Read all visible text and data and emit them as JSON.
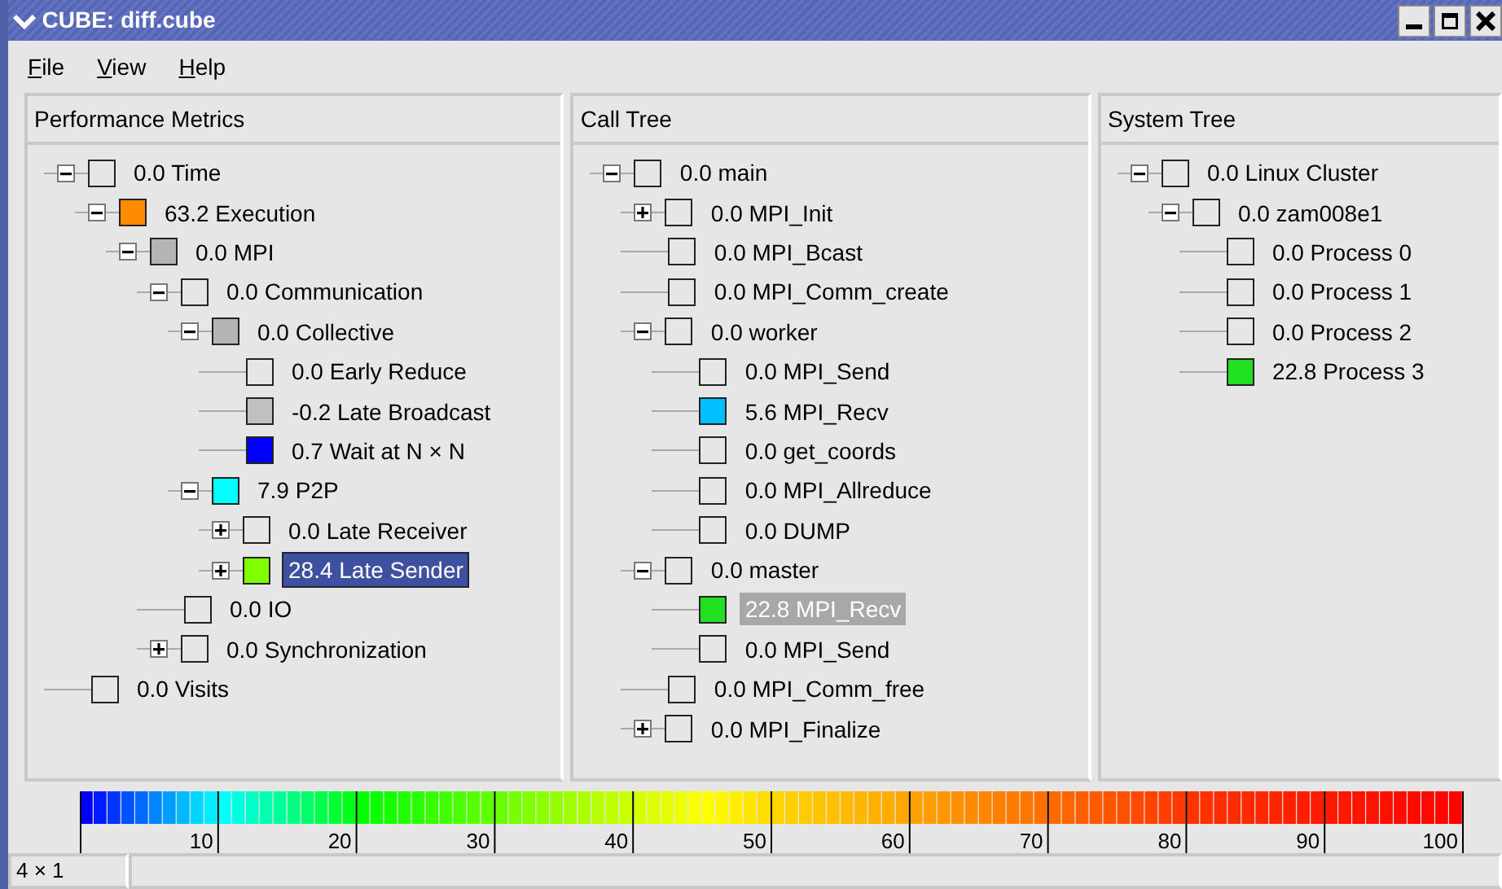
{
  "window": {
    "title": "CUBE:  diff.cube"
  },
  "menu": [
    {
      "label": "File"
    },
    {
      "label": "View"
    },
    {
      "label": "Help"
    }
  ],
  "panels": [
    {
      "title": "Performance Metrics",
      "tree": [
        {
          "label": "0.0 Time",
          "color": "#e6e6e6",
          "expanded": true,
          "selected": false,
          "children": [
            {
              "label": "63.2 Execution",
              "color": "#ff8c00",
              "expanded": true,
              "selected": false,
              "children": [
                {
                  "label": "0.0 MPI",
                  "color": "#b4b4b4",
                  "expanded": true,
                  "selected": false,
                  "children": [
                    {
                      "label": "0.0 Communication",
                      "color": "#e6e6e6",
                      "expanded": true,
                      "selected": false,
                      "children": [
                        {
                          "label": "0.0 Collective",
                          "color": "#b4b4b4",
                          "expanded": true,
                          "selected": false,
                          "children": [
                            {
                              "label": "0.0 Early Reduce",
                              "color": "#e6e6e6",
                              "selected": false
                            },
                            {
                              "label": "-0.2 Late Broadcast",
                              "color": "#c0c0c0",
                              "selected": false
                            },
                            {
                              "label": "0.7 Wait at N × N",
                              "color": "#0000ff",
                              "selected": false
                            }
                          ]
                        },
                        {
                          "label": "7.9 P2P",
                          "color": "#00ffff",
                          "expanded": true,
                          "selected": false,
                          "children": [
                            {
                              "label": "0.0 Late Receiver",
                              "color": "#e6e6e6",
                              "expanded": false,
                              "selected": false
                            },
                            {
                              "label": "28.4 Late Sender",
                              "color": "#80ff00",
                              "expanded": false,
                              "selected": true,
                              "focused": true
                            }
                          ]
                        }
                      ]
                    },
                    {
                      "label": "0.0 IO",
                      "color": "#e6e6e6",
                      "selected": false
                    },
                    {
                      "label": "0.0 Synchronization",
                      "color": "#e6e6e6",
                      "expanded": false,
                      "selected": false
                    }
                  ]
                }
              ]
            }
          ]
        },
        {
          "label": "0.0 Visits",
          "color": "#e6e6e6",
          "selected": false
        }
      ]
    },
    {
      "title": "Call Tree",
      "tree": [
        {
          "label": "0.0 main",
          "color": "#e6e6e6",
          "expanded": true,
          "selected": false,
          "children": [
            {
              "label": "0.0 MPI_Init",
              "color": "#e6e6e6",
              "expanded": false,
              "selected": false
            },
            {
              "label": "0.0 MPI_Bcast",
              "color": "#e6e6e6",
              "selected": false
            },
            {
              "label": "0.0 MPI_Comm_create",
              "color": "#e6e6e6",
              "selected": false
            },
            {
              "label": "0.0 worker",
              "color": "#e6e6e6",
              "expanded": true,
              "selected": false,
              "children": [
                {
                  "label": "0.0 MPI_Send",
                  "color": "#e6e6e6",
                  "selected": false
                },
                {
                  "label": "5.6 MPI_Recv",
                  "color": "#00bfff",
                  "selected": false
                },
                {
                  "label": "0.0 get_coords",
                  "color": "#e6e6e6",
                  "selected": false
                },
                {
                  "label": "0.0 MPI_Allreduce",
                  "color": "#e6e6e6",
                  "selected": false
                },
                {
                  "label": "0.0 DUMP",
                  "color": "#e6e6e6",
                  "selected": false
                }
              ]
            },
            {
              "label": "0.0 master",
              "color": "#e6e6e6",
              "expanded": true,
              "selected": false,
              "children": [
                {
                  "label": "22.8 MPI_Recv",
                  "color": "#20e020",
                  "selected": true,
                  "focused": false
                },
                {
                  "label": "0.0 MPI_Send",
                  "color": "#e6e6e6",
                  "selected": false
                }
              ]
            },
            {
              "label": "0.0 MPI_Comm_free",
              "color": "#e6e6e6",
              "selected": false
            },
            {
              "label": "0.0 MPI_Finalize",
              "color": "#e6e6e6",
              "expanded": false,
              "selected": false
            }
          ]
        }
      ]
    },
    {
      "title": "System Tree",
      "tree": [
        {
          "label": "0.0 Linux Cluster",
          "color": "#e6e6e6",
          "expanded": true,
          "selected": false,
          "children": [
            {
              "label": "0.0 zam008e1",
              "color": "#e6e6e6",
              "expanded": true,
              "selected": false,
              "children": [
                {
                  "label": "0.0 Process 0",
                  "color": "#e6e6e6",
                  "selected": false
                },
                {
                  "label": "0.0 Process 1",
                  "color": "#e6e6e6",
                  "selected": false
                },
                {
                  "label": "0.0 Process 2",
                  "color": "#e6e6e6",
                  "selected": false
                },
                {
                  "label": "22.8 Process 3",
                  "color": "#20e020",
                  "selected": false
                }
              ]
            }
          ]
        }
      ]
    }
  ],
  "scale": {
    "ticks": [
      "10",
      "20",
      "30",
      "40",
      "50",
      "60",
      "70",
      "80",
      "90",
      "100"
    ]
  },
  "status_bar": {
    "size": "4 × 1"
  }
}
